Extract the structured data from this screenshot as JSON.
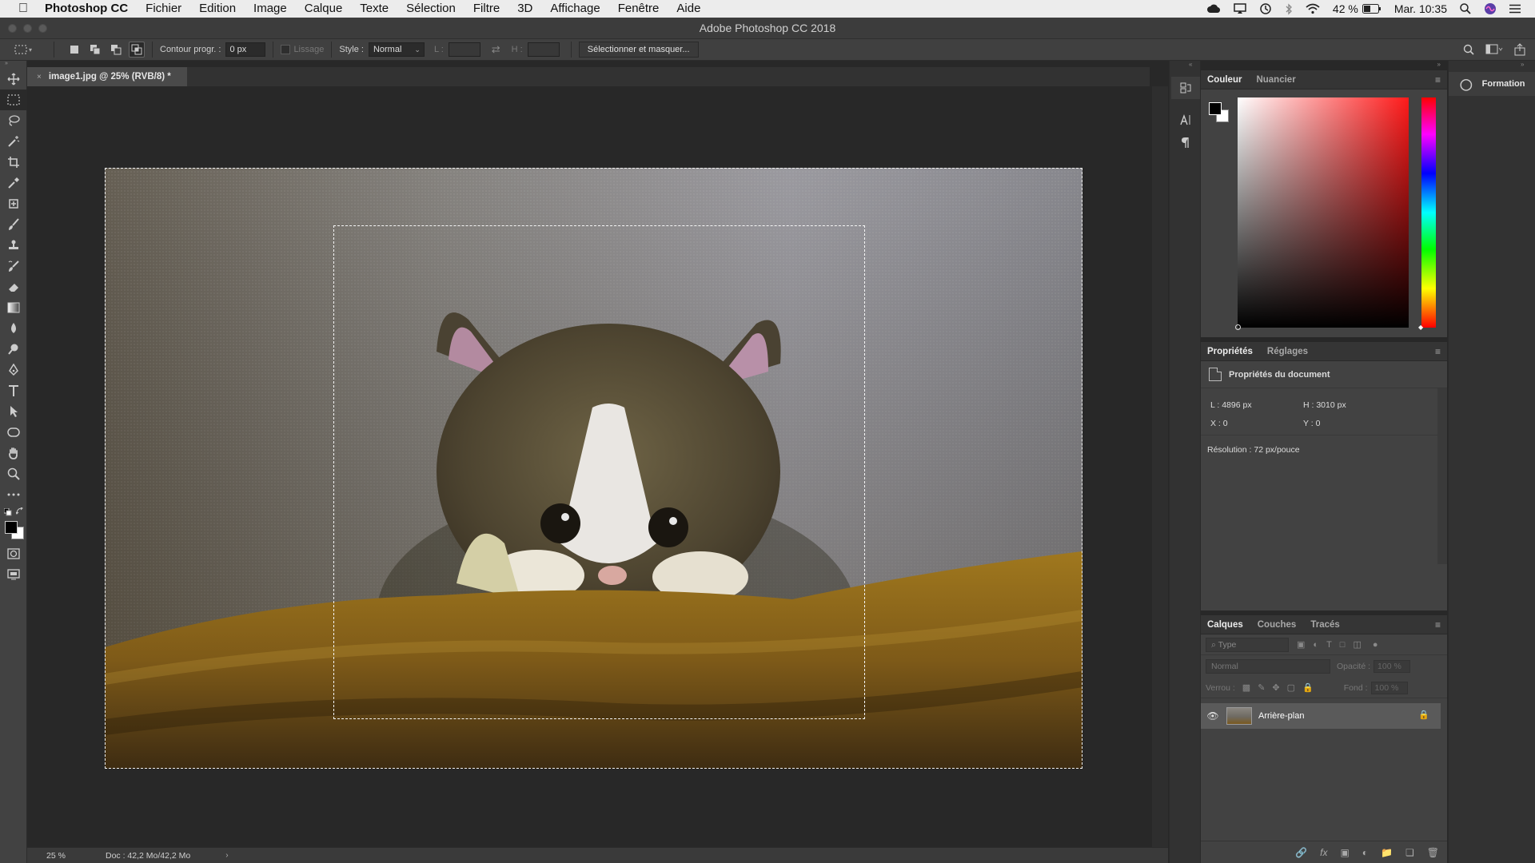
{
  "macos_menubar": {
    "app_name": "Photoshop CC",
    "menus": [
      "Fichier",
      "Edition",
      "Image",
      "Calque",
      "Texte",
      "Sélection",
      "Filtre",
      "3D",
      "Affichage",
      "Fenêtre",
      "Aide"
    ],
    "battery": "42 %",
    "clock": "Mar. 10:35"
  },
  "window": {
    "title": "Adobe Photoshop CC 2018"
  },
  "options_bar": {
    "feather_label": "Contour progr. :",
    "feather_value": "0 px",
    "antialias_label": "Lissage",
    "style_label": "Style :",
    "style_value": "Normal",
    "width_label": "L :",
    "height_label": "H :",
    "select_mask_button": "Sélectionner et masquer..."
  },
  "document": {
    "tab_title": "image1.jpg @ 25% (RVB/8) *",
    "tab_close": "×"
  },
  "status_bar": {
    "zoom": "25 %",
    "doc_info": "Doc : 42,2 Mo/42,2 Mo",
    "arrow": "›"
  },
  "color_panel": {
    "tabs": [
      "Couleur",
      "Nuancier"
    ],
    "foreground_color": "#000000",
    "background_color": "#ffffff",
    "hue_color": "#ff1a1a"
  },
  "properties_panel": {
    "tabs": [
      "Propriétés",
      "Réglages"
    ],
    "section_title": "Propriétés du document",
    "width": "L : 4896 px",
    "height": "H : 3010 px",
    "x": "X : 0",
    "y": "Y : 0",
    "resolution": "Résolution : 72 px/pouce"
  },
  "layers_panel": {
    "tabs": [
      "Calques",
      "Couches",
      "Tracés"
    ],
    "filter_placeholder": "Type",
    "blend_mode": "Normal",
    "opacity_label": "Opacité :",
    "opacity_value": "100 %",
    "lock_label": "Verrou :",
    "fill_label": "Fond :",
    "fill_value": "100 %",
    "layers": [
      {
        "name": "Arrière-plan",
        "visible": true,
        "locked": true
      }
    ]
  },
  "learn_panel": {
    "label": "Formation"
  }
}
